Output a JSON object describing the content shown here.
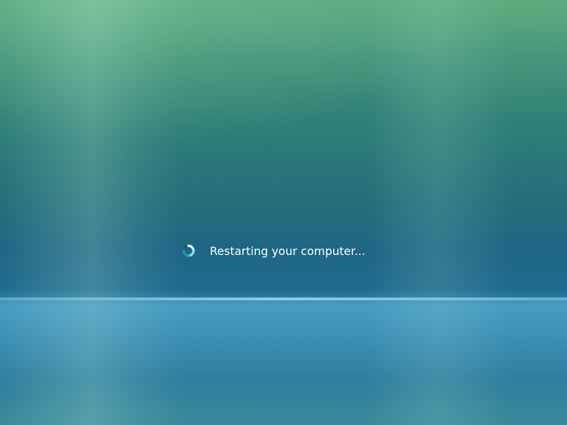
{
  "screen": {
    "status_text": "Restarting your computer...",
    "spinner_icon": "loading-spinner-icon"
  },
  "colors": {
    "background_top": "#55a37a",
    "background_mid": "#1f6684",
    "horizon": "#aae1f0",
    "spinner_light": "#e8fbff",
    "spinner_dark": "#1c9ec0",
    "text": "#ffffff"
  }
}
